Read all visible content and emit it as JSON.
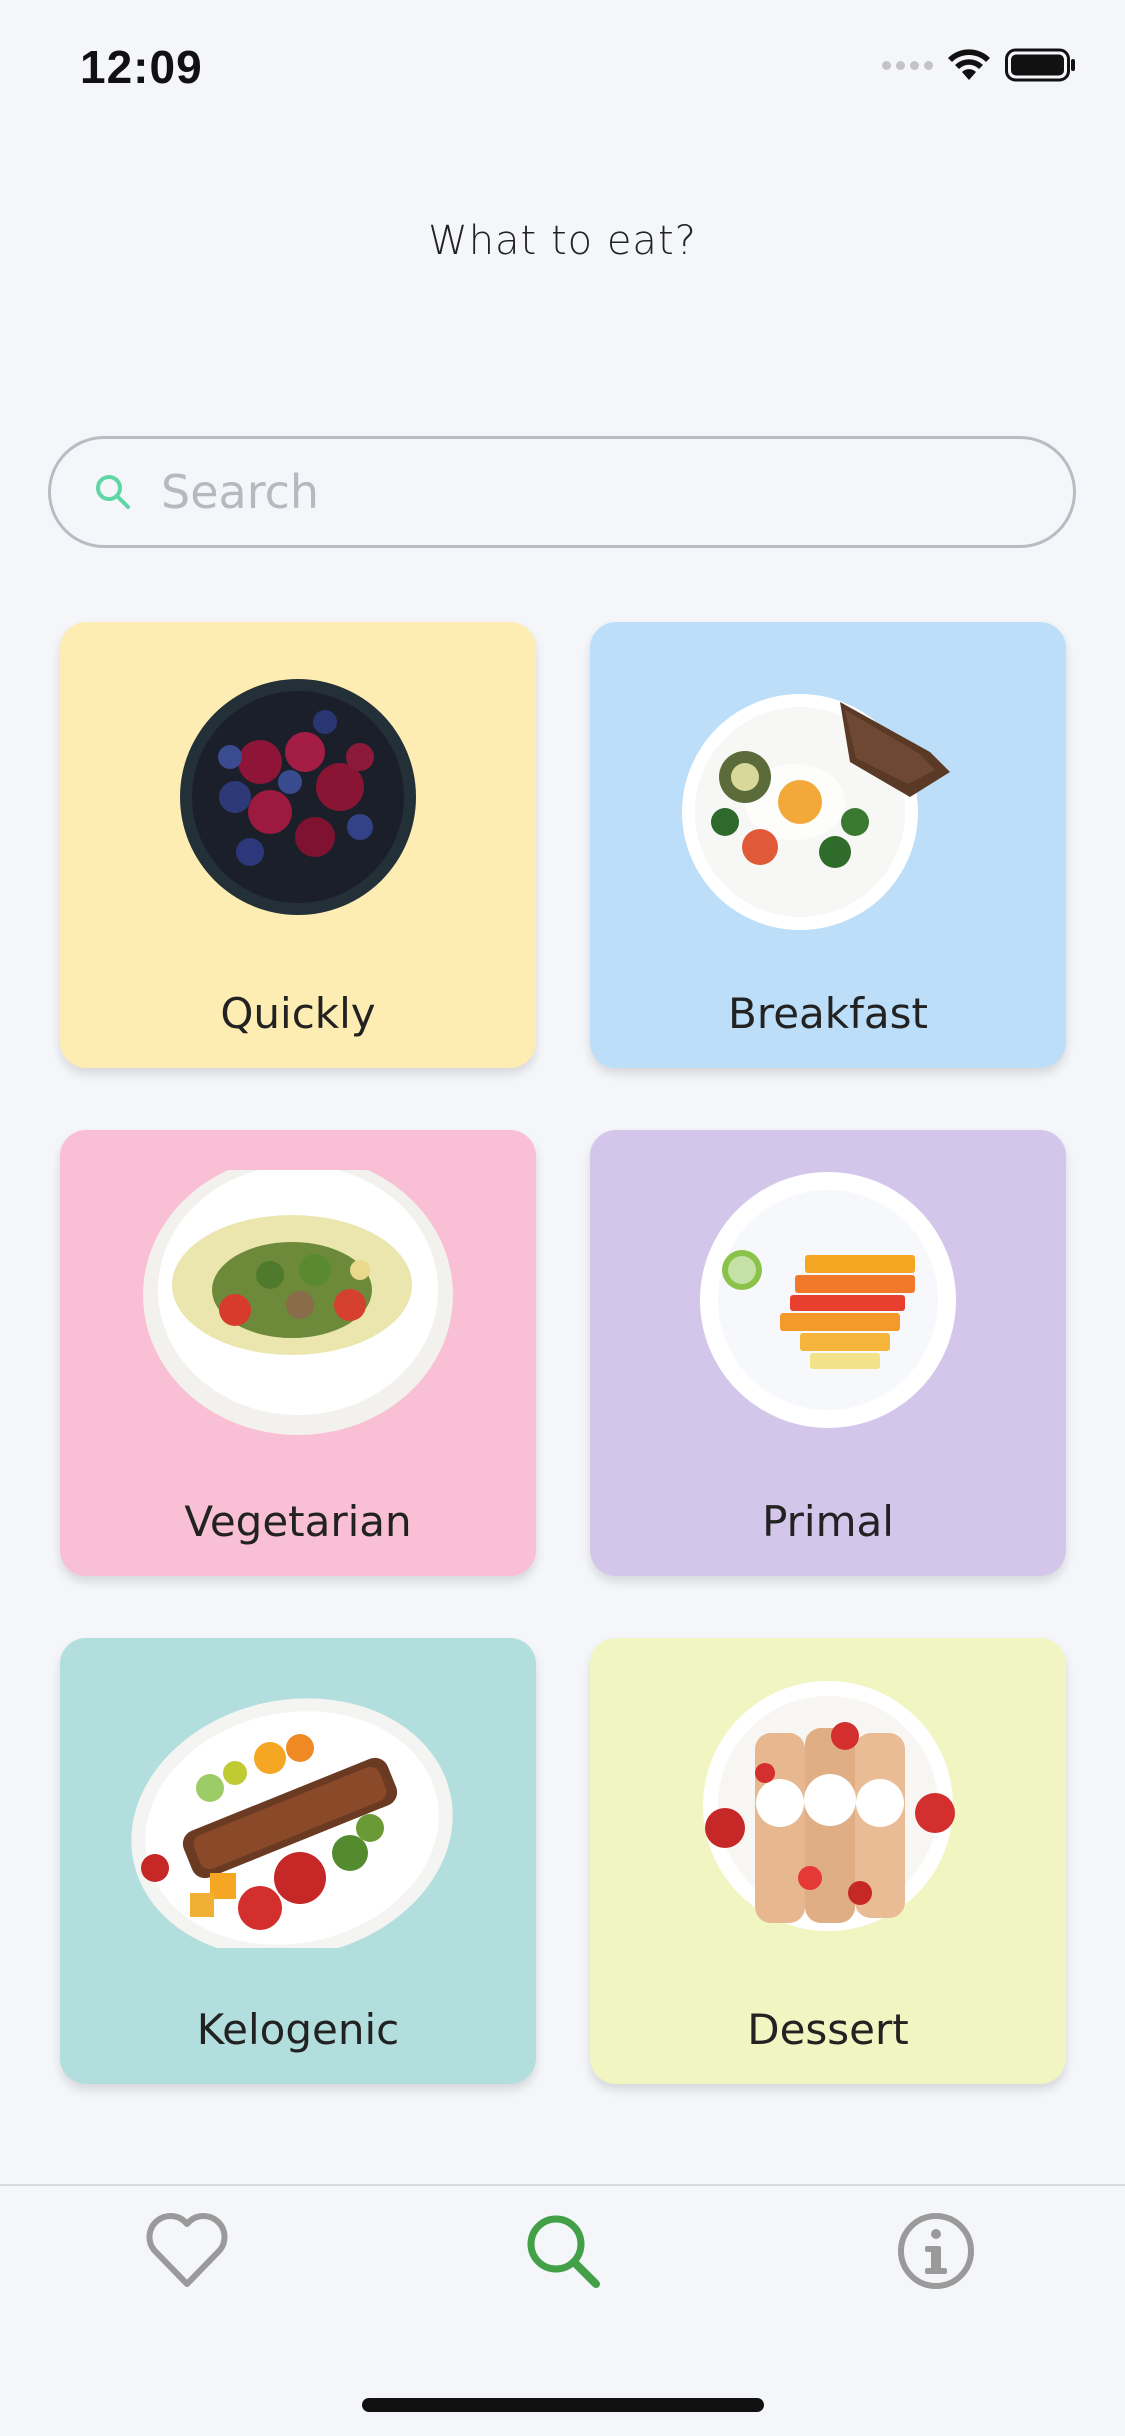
{
  "status_bar": {
    "time": "12:09"
  },
  "header": {
    "title": "What to eat?"
  },
  "search": {
    "placeholder": "Search",
    "value": ""
  },
  "categories": [
    {
      "label": "Quickly",
      "color": "#feedb3",
      "image": "bowl-of-cherries-and-blueberries"
    },
    {
      "label": "Breakfast",
      "color": "#bcdef9",
      "image": "plate-of-egg-avocado-and-toast"
    },
    {
      "label": "Vegetarian",
      "color": "#f9bfd4",
      "image": "plate-of-green-salad"
    },
    {
      "label": "Primal",
      "color": "#d4c6ea",
      "image": "plate-of-sliced-fruit"
    },
    {
      "label": "Kelogenic",
      "color": "#b2dfdd",
      "image": "plate-of-grilled-meat-and-vegetables"
    },
    {
      "label": "Dessert",
      "color": "#f0f5c2",
      "image": "plate-of-crepes-with-strawberries"
    }
  ],
  "tab_bar": {
    "active_color": "#43a047",
    "inactive_color": "#9a9a9a",
    "tabs": [
      {
        "icon": "heart-icon",
        "active": false
      },
      {
        "icon": "search-icon",
        "active": true
      },
      {
        "icon": "info-icon",
        "active": false
      }
    ]
  }
}
